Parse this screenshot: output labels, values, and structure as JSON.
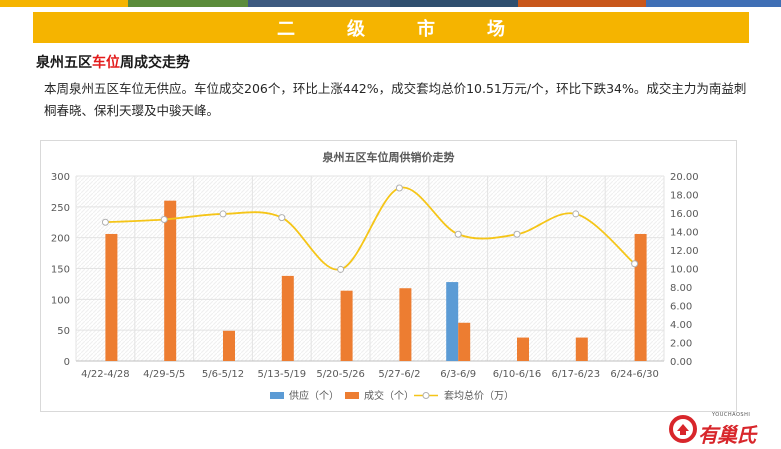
{
  "header": {
    "title": "二级市场",
    "stripe_colors": [
      "#f5b400",
      "#5b8c3a",
      "#3d5a80",
      "#2f4f6f",
      "#c8571b",
      "#3f6fb5",
      "#7a7a7a"
    ]
  },
  "section": {
    "heading_prefix": "泉州五区",
    "heading_highlight": "车位",
    "heading_suffix": "周成交走势",
    "summary": "本周泉州五区车位无供应。车位成交206个，环比上涨442%，成交套均总价10.51万元/个，环比下跌34%。成交主力为南益刺桐春晓、保利天璎及中骏天峰。"
  },
  "chart_data": {
    "type": "bar+line",
    "title": "泉州五区车位周供销价走势",
    "categories": [
      "4/22-4/28",
      "4/29-5/5",
      "5/6-5/12",
      "5/13-5/19",
      "5/20-5/26",
      "5/27-6/2",
      "6/3-6/9",
      "6/10-6/16",
      "6/17-6/23",
      "6/24-6/30"
    ],
    "series": [
      {
        "name": "供应（个）",
        "type": "bar",
        "axis": "left",
        "color": "#5b9bd5",
        "values": [
          0,
          0,
          0,
          0,
          0,
          0,
          128,
          0,
          0,
          0
        ]
      },
      {
        "name": "成交（个）",
        "type": "bar",
        "axis": "left",
        "color": "#ed7d31",
        "values": [
          206,
          260,
          49,
          138,
          114,
          118,
          62,
          38,
          38,
          206
        ]
      },
      {
        "name": "套均总价（万）",
        "type": "line",
        "axis": "right",
        "color": "#f5c518",
        "values": [
          15.0,
          15.3,
          15.9,
          15.5,
          9.9,
          18.7,
          13.7,
          13.7,
          15.9,
          10.51
        ]
      }
    ],
    "left_axis": {
      "min": 0,
      "max": 300,
      "ticks": [
        "0",
        "50",
        "100",
        "150",
        "200",
        "250",
        "300"
      ]
    },
    "right_axis": {
      "min": 0,
      "max": 20,
      "ticks": [
        "0.00",
        "2.00",
        "4.00",
        "6.00",
        "8.00",
        "10.00",
        "12.00",
        "14.00",
        "16.00",
        "18.00",
        "20.00"
      ]
    },
    "grid": true,
    "legend_position": "bottom"
  },
  "logo": {
    "name": "有巢氏",
    "subtitle": "YOUCHAOSHI"
  }
}
